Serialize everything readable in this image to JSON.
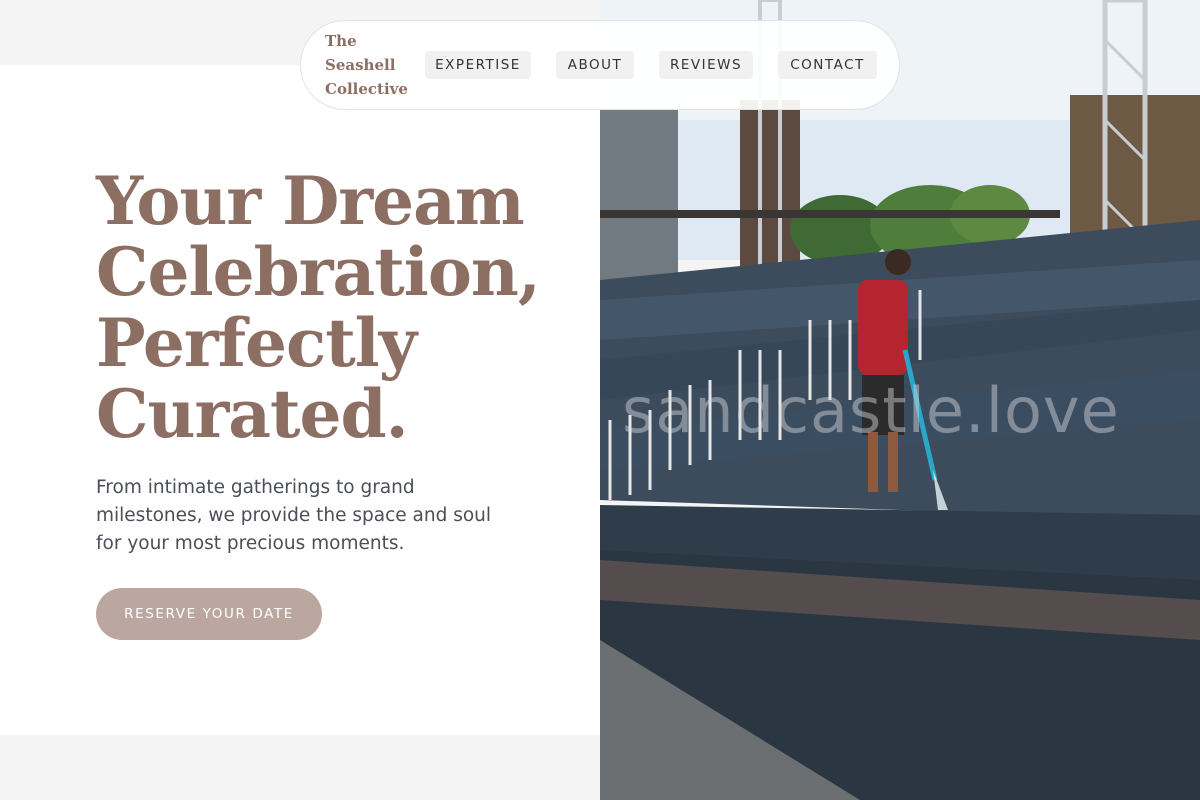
{
  "brand": {
    "logo_line1": "The",
    "logo_line2": "Seashell",
    "logo_line3": "Collective"
  },
  "nav": {
    "items": [
      {
        "label": "EXPERTISE"
      },
      {
        "label": "ABOUT"
      },
      {
        "label": "REVIEWS"
      },
      {
        "label": "CONTACT"
      }
    ]
  },
  "hero": {
    "title_line1": "Your Dream",
    "title_line2": "Celebration,",
    "title_line3": "Perfectly",
    "title_line4": "Curated.",
    "subtitle": "From intimate gatherings to grand milestones, we provide the space and soul for your most precious moments.",
    "cta_label": "RESERVE YOUR DATE"
  },
  "photo": {
    "watermark": "sandcastle.love"
  },
  "colors": {
    "accent": "#8d6e63",
    "cta_bg": "#bba79f",
    "body_text": "#4a4f57"
  }
}
